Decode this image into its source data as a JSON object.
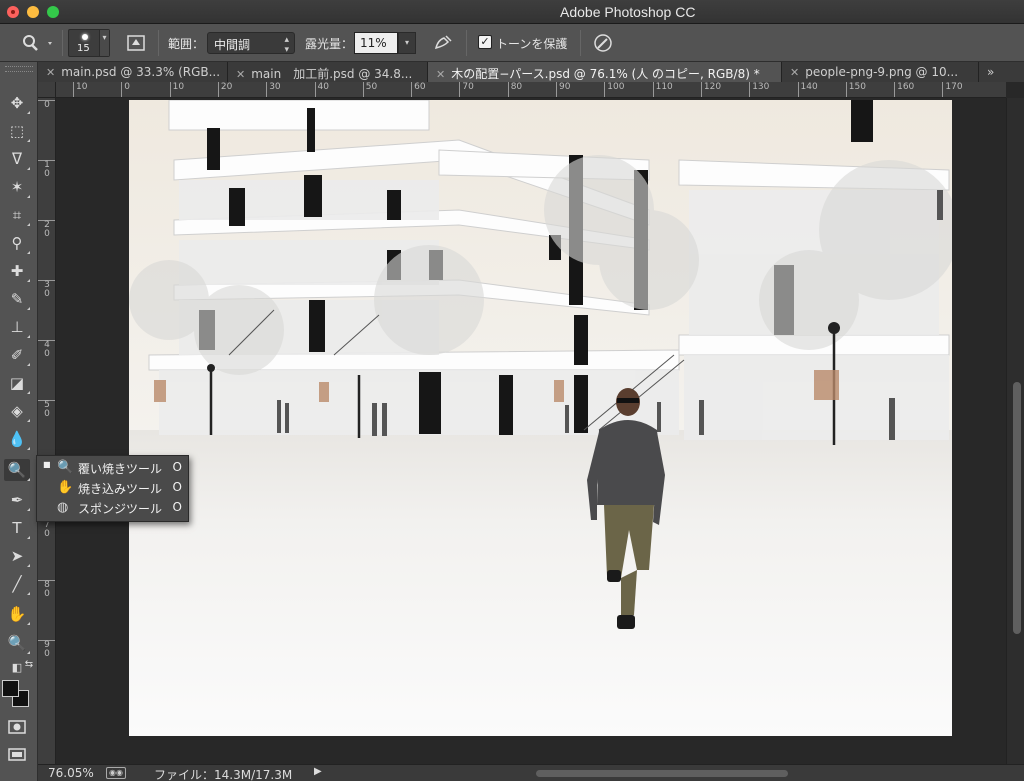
{
  "app": {
    "title": "Adobe Photoshop CC"
  },
  "options_bar": {
    "brush_size": "15",
    "range_label": "範囲：",
    "range_value": "中間調",
    "exposure_label": "露光量：",
    "exposure_value": "11%",
    "protect_tones_label": "トーンを保護",
    "protect_tones_checked": true
  },
  "tabs": [
    {
      "label": "main.psd @ 33.3% (RGB...",
      "active": false
    },
    {
      "label": "main　加工前.psd @ 34.8...",
      "active": false
    },
    {
      "label": "木の配置−パース.psd @ 76.1% (人 のコピー, RGB/8) *",
      "active": true
    },
    {
      "label": "people-png-9.png @ 10...",
      "active": false
    }
  ],
  "ruler_h": [
    "10",
    "0",
    "10",
    "20",
    "30",
    "40",
    "50",
    "60",
    "70",
    "80",
    "90",
    "100",
    "110",
    "120",
    "130",
    "140",
    "150",
    "160",
    "170"
  ],
  "ruler_v": [
    "0",
    "1 0",
    "2 0",
    "3 0",
    "4 0",
    "5 0",
    "6 0",
    "7 0",
    "8 0",
    "9 0"
  ],
  "tools": [
    {
      "name": "move-tool-icon",
      "glyph": "✥"
    },
    {
      "name": "marquee-tool-icon",
      "glyph": "⬚"
    },
    {
      "name": "lasso-tool-icon",
      "glyph": "ᐁ"
    },
    {
      "name": "magic-wand-tool-icon",
      "glyph": "✶"
    },
    {
      "name": "crop-tool-icon",
      "glyph": "⌗"
    },
    {
      "name": "eyedropper-tool-icon",
      "glyph": "⚲"
    },
    {
      "name": "healing-brush-tool-icon",
      "glyph": "✚"
    },
    {
      "name": "brush-tool-icon",
      "glyph": "✎"
    },
    {
      "name": "clone-stamp-tool-icon",
      "glyph": "⊥"
    },
    {
      "name": "history-brush-tool-icon",
      "glyph": "✐"
    },
    {
      "name": "eraser-tool-icon",
      "glyph": "◪"
    },
    {
      "name": "paint-bucket-tool-icon",
      "glyph": "◈"
    },
    {
      "name": "blur-tool-icon",
      "glyph": "💧"
    },
    {
      "name": "dodge-tool-icon",
      "glyph": "🔍"
    },
    {
      "name": "pen-tool-icon",
      "glyph": "✒"
    },
    {
      "name": "type-tool-icon",
      "glyph": "T"
    },
    {
      "name": "path-selection-tool-icon",
      "glyph": "➤"
    },
    {
      "name": "line-tool-icon",
      "glyph": "╱"
    },
    {
      "name": "hand-tool-icon",
      "glyph": "✋"
    },
    {
      "name": "zoom-tool-icon",
      "glyph": "🔍"
    }
  ],
  "flyout": {
    "items": [
      {
        "label": "覆い焼きツール",
        "shortcut": "O",
        "selected": true,
        "icon": "dodge-icon"
      },
      {
        "label": "焼き込みツール",
        "shortcut": "O",
        "selected": false,
        "icon": "burn-icon"
      },
      {
        "label": "スポンジツール",
        "shortcut": "O",
        "selected": false,
        "icon": "sponge-icon"
      }
    ]
  },
  "status": {
    "zoom": "76.05%",
    "file_info": "ファイル：14.3M/17.3M"
  }
}
